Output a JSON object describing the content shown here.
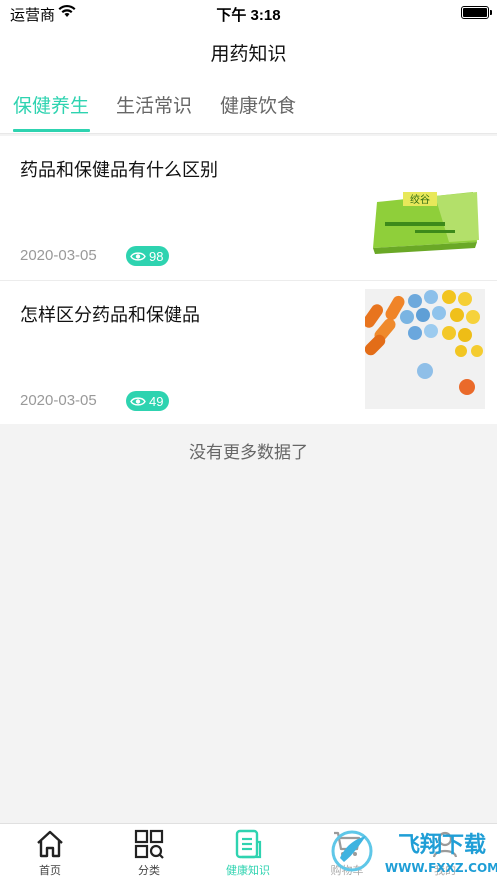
{
  "status_bar": {
    "carrier": "运营商",
    "time": "下午 3:18"
  },
  "nav": {
    "title": "用药知识"
  },
  "tabs": [
    {
      "label": "保健养生",
      "active": true
    },
    {
      "label": "生活常识",
      "active": false
    },
    {
      "label": "健康饮食",
      "active": false
    }
  ],
  "articles": [
    {
      "title": "药品和保健品有什么区别",
      "date": "2020-03-05",
      "views": "98",
      "thumb": "tea-package-image",
      "thumb_text": "绞谷"
    },
    {
      "title": "怎样区分药品和保健品",
      "date": "2020-03-05",
      "views": "49",
      "thumb": "colorful-pills-image"
    }
  ],
  "no_more": "没有更多数据了",
  "bottom_tabs": [
    {
      "label": "首页",
      "icon": "home-icon"
    },
    {
      "label": "分类",
      "icon": "category-icon"
    },
    {
      "label": "健康知识",
      "icon": "health-knowledge-icon",
      "active": true
    },
    {
      "label": "购物车",
      "icon": "cart-icon"
    },
    {
      "label": "我的",
      "icon": "profile-icon"
    }
  ],
  "watermark": {
    "brand": "飞翔下载",
    "url": "WWW.FXXZ.COM"
  },
  "colors": {
    "accent": "#2ed3b0",
    "background": "#f3f3f3"
  }
}
